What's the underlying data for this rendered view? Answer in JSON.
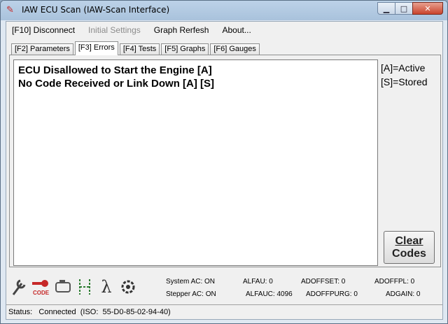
{
  "window": {
    "title": "IAW ECU Scan (IAW-Scan Interface)"
  },
  "menu": {
    "items": [
      {
        "label": "[F10] Disconnect",
        "enabled": true
      },
      {
        "label": "Initial Settings",
        "enabled": false
      },
      {
        "label": "Graph Rerfesh",
        "enabled": true
      },
      {
        "label": "About...",
        "enabled": true
      }
    ]
  },
  "tabs": [
    {
      "label": "[F2] Parameters",
      "active": false
    },
    {
      "label": "[F3] Errors",
      "active": true
    },
    {
      "label": "[F4] Tests",
      "active": false
    },
    {
      "label": "[F5] Graphs",
      "active": false
    },
    {
      "label": "[F6] Gauges",
      "active": false
    }
  ],
  "errors": [
    "ECU Disallowed to Start the Engine [A]",
    "No Code Received or Link Down [A] [S]"
  ],
  "legend": {
    "active": "[A]=Active",
    "stored": "[S]=Stored"
  },
  "clear_button": {
    "line1": "Clear",
    "line2": "Codes"
  },
  "status_icons": [
    {
      "name": "wrench-icon"
    },
    {
      "name": "code-key-icon",
      "text": "CODE"
    },
    {
      "name": "engine-icon"
    },
    {
      "name": "hydraulic-icon"
    },
    {
      "name": "lambda-icon",
      "text": "λ"
    },
    {
      "name": "snowflake-icon"
    }
  ],
  "values": {
    "system_ac": "System AC: ON",
    "stepper_ac": "Stepper AC: ON",
    "alfau": "ALFAU: 0",
    "alfauc": "ALFAUC: 4096",
    "adoffset": "ADOFFSET: 0",
    "adoffpurg": "ADOFFPURG: 0",
    "adoffpl": "ADOFFPL: 0",
    "adgain": "ADGAIN: 0"
  },
  "status": {
    "text": "Status:   Connected  (ISO:  55-D0-85-02-94-40)"
  },
  "colors": {
    "accent_red": "#c62828",
    "title_gradient_top": "#bcd2e8"
  }
}
